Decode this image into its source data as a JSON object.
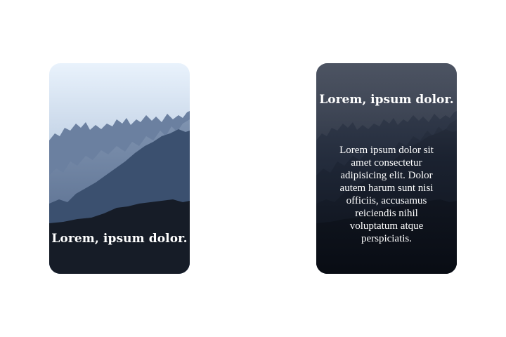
{
  "cards": [
    {
      "title": "Lorem, ipsum dolor."
    },
    {
      "title": "Lorem, ipsum dolor.",
      "body": "Lorem ipsum dolor sit amet consectetur adipisicing elit. Dolor autem harum sunt nisi officiis, accusamus reiciendis nihil voluptatum atque perspiciatis."
    }
  ],
  "colors": {
    "sky_top": "#e6f0fb",
    "ridge_far": "#5f7595",
    "ridge_mid": "#3f5474",
    "ridge_near": "#273954",
    "foreground": "#151b26"
  }
}
